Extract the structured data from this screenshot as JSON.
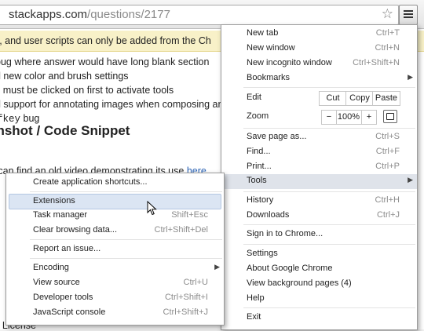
{
  "browser": {
    "url_host": "stackapps.com",
    "url_path": "/questions/2177",
    "icons": [
      "star-icon",
      "chrome-menu-icon"
    ]
  },
  "page": {
    "notice": "ps, and user scripts can only be added from the Ch",
    "bullets": [
      "bug where answer would have long blank section",
      "d new color and brush settings",
      "s must be clicked on first to activate tools",
      "d support for annotating images when composing an"
    ],
    "code_bullet": {
      "code": "fkey",
      "text": "bug"
    },
    "heading": "enshot / Code Snippet",
    "video_text": "ou can find an old video demonstrating its use ",
    "video_link": "here",
    "license": "T License"
  },
  "main_menu": {
    "new_tab": {
      "label": "New tab",
      "shortcut": "Ctrl+T"
    },
    "new_window": {
      "label": "New window",
      "shortcut": "Ctrl+N"
    },
    "new_incognito": {
      "label": "New incognito window",
      "shortcut": "Ctrl+Shift+N"
    },
    "bookmarks": {
      "label": "Bookmarks"
    },
    "edit": {
      "label": "Edit",
      "cut": "Cut",
      "copy": "Copy",
      "paste": "Paste"
    },
    "zoom": {
      "label": "Zoom",
      "minus": "−",
      "level": "100%",
      "plus": "+"
    },
    "save_page": {
      "label": "Save page as...",
      "shortcut": "Ctrl+S"
    },
    "find": {
      "label": "Find...",
      "shortcut": "Ctrl+F"
    },
    "print": {
      "label": "Print...",
      "shortcut": "Ctrl+P"
    },
    "tools": {
      "label": "Tools"
    },
    "history": {
      "label": "History",
      "shortcut": "Ctrl+H"
    },
    "downloads": {
      "label": "Downloads",
      "shortcut": "Ctrl+J"
    },
    "sign_in": {
      "label": "Sign in to Chrome..."
    },
    "settings": {
      "label": "Settings"
    },
    "about": {
      "label": "About Google Chrome"
    },
    "background_pages": {
      "label": "View background pages (4)"
    },
    "help": {
      "label": "Help"
    },
    "exit": {
      "label": "Exit"
    }
  },
  "tools_menu": {
    "create_shortcuts": {
      "label": "Create application shortcuts..."
    },
    "extensions": {
      "label": "Extensions"
    },
    "task_manager": {
      "label": "Task manager",
      "shortcut": "Shift+Esc"
    },
    "clear_data": {
      "label": "Clear browsing data...",
      "shortcut": "Ctrl+Shift+Del"
    },
    "report_issue": {
      "label": "Report an issue..."
    },
    "encoding": {
      "label": "Encoding"
    },
    "view_source": {
      "label": "View source",
      "shortcut": "Ctrl+U"
    },
    "dev_tools": {
      "label": "Developer tools",
      "shortcut": "Ctrl+Shift+I"
    },
    "js_console": {
      "label": "JavaScript console",
      "shortcut": "Ctrl+Shift+J"
    }
  }
}
